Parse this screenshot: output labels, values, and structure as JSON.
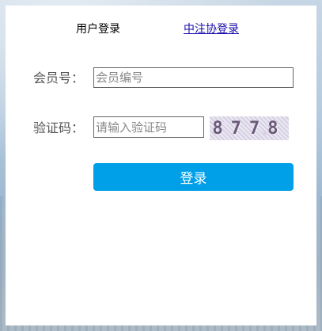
{
  "tabs": {
    "active_label": "用户登录",
    "link_label": "中注协登录"
  },
  "form": {
    "member_label": "会员号：",
    "member_placeholder": "会员编号",
    "captcha_label": "验证码：",
    "captcha_placeholder": "请输入验证码",
    "captcha_text": "8778",
    "submit_label": "登录"
  },
  "colors": {
    "button_bg": "#00a0e9",
    "link": "#1a0dab"
  }
}
